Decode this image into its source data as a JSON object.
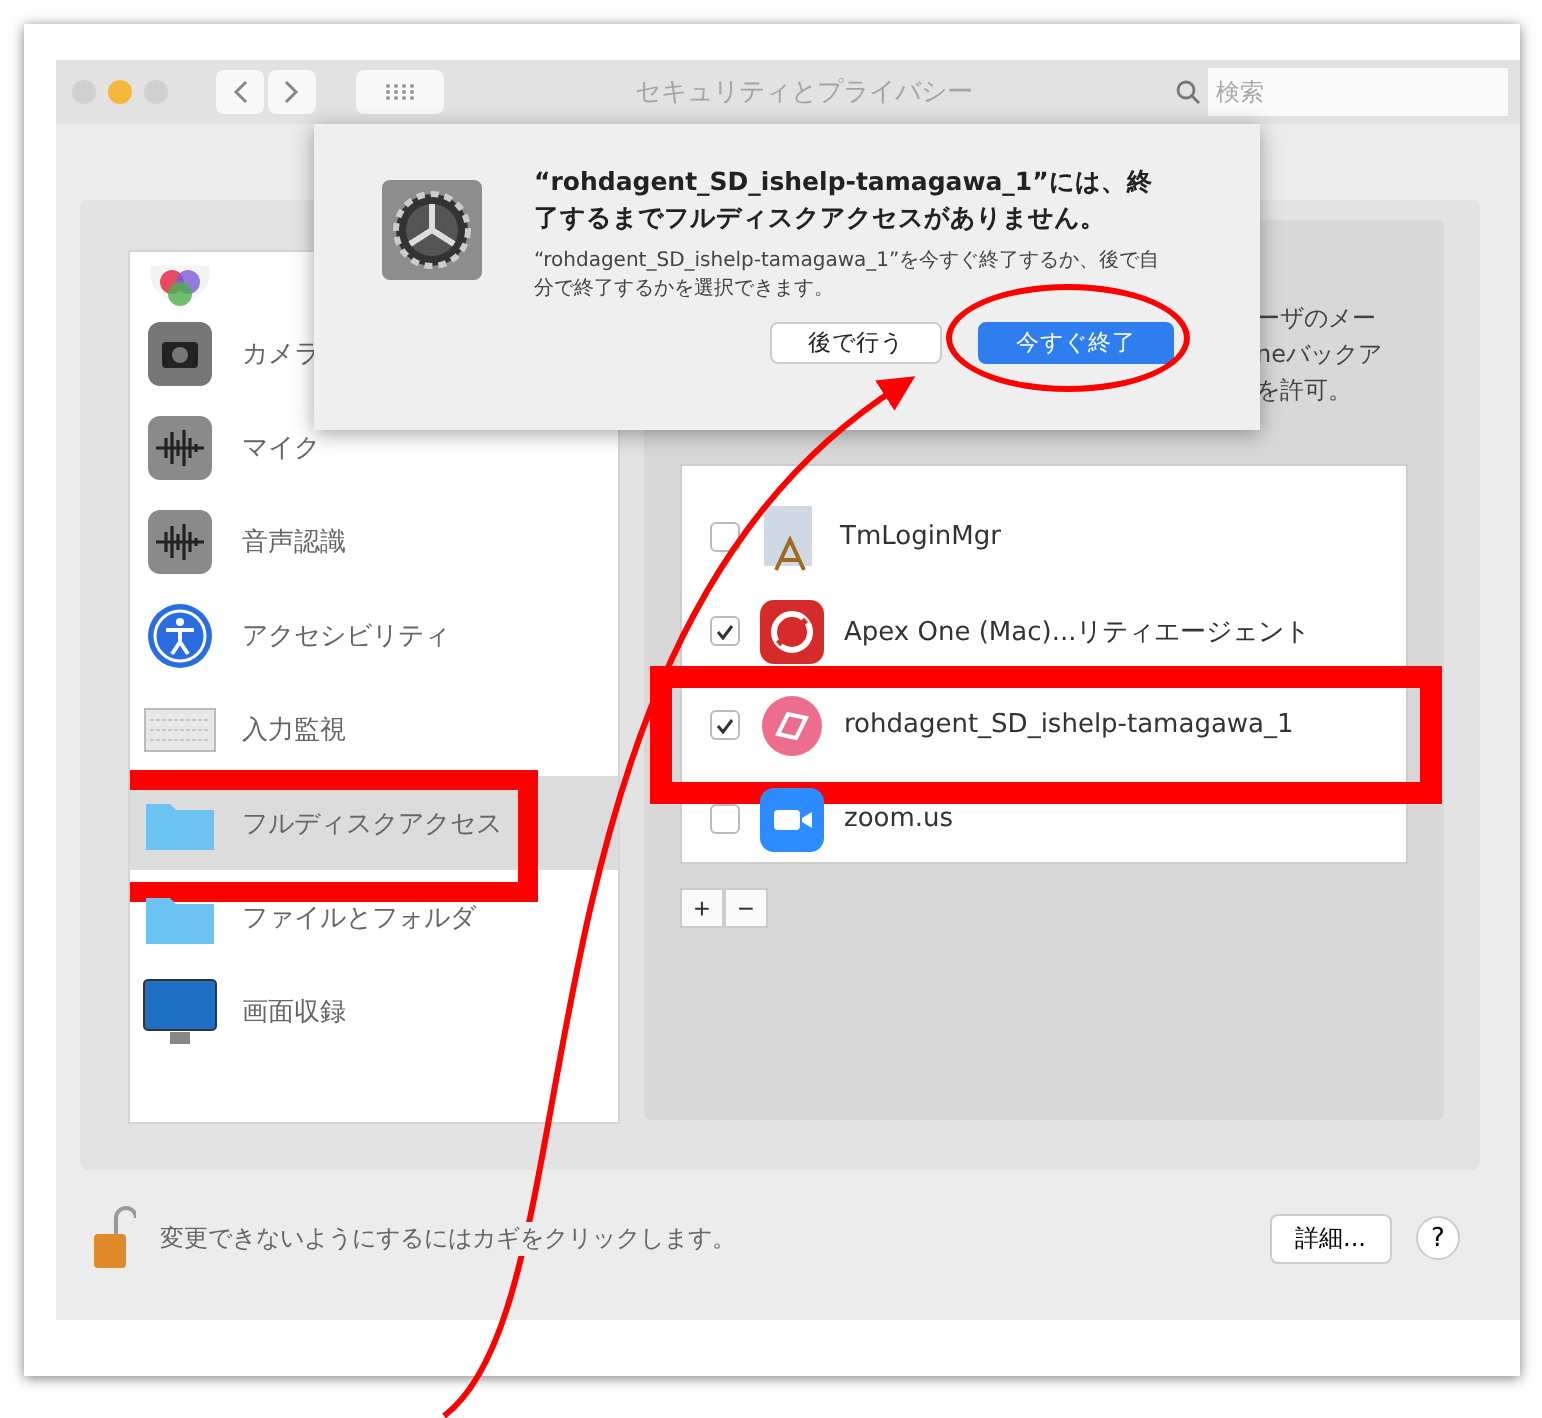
{
  "window": {
    "title": "セキュリティとプライバシー",
    "search_placeholder": "検索"
  },
  "dialog": {
    "title": "“rohdagent_SD_ishelp-tamagawa_1”には、終了するまでフルディスクアクセスがありません。",
    "message": "“rohdagent_SD_ishelp-tamagawa_1”を今すぐ終了するか、後で自分で終了するかを選択できます。",
    "buttons": [
      {
        "label": "後で行う",
        "kind": "secondary"
      },
      {
        "label": "今すぐ終了",
        "kind": "primary",
        "annotated": true
      }
    ]
  },
  "sidebar": {
    "items": [
      {
        "label": "カメラ",
        "selected": false
      },
      {
        "label": "マイク",
        "selected": false
      },
      {
        "label": "音声認識",
        "selected": false
      },
      {
        "label": "アクセシビリティ",
        "selected": false
      },
      {
        "label": "入力監視",
        "selected": false
      },
      {
        "label": "フルディスクアクセス",
        "selected": true,
        "annotated": true
      },
      {
        "label": "ファイルとフォルダ",
        "selected": false
      },
      {
        "label": "画面収録",
        "selected": false
      }
    ]
  },
  "description": [
    "ーザのメー",
    "neバックア",
    "を許可。"
  ],
  "apps": [
    {
      "name": "TmLoginMgr",
      "checked": false
    },
    {
      "name": "Apex One (Mac)...リティエージェント",
      "checked": true
    },
    {
      "name": "rohdagent_SD_ishelp-tamagawa_1",
      "checked": true,
      "annotated": true
    },
    {
      "name": "zoom.us",
      "checked": false
    }
  ],
  "list_buttons": [
    "+",
    "−"
  ],
  "footer": {
    "lock_text": "変更できないようにするにはカギをクリックします。",
    "details_button": "詳細...",
    "help_button": "?"
  }
}
